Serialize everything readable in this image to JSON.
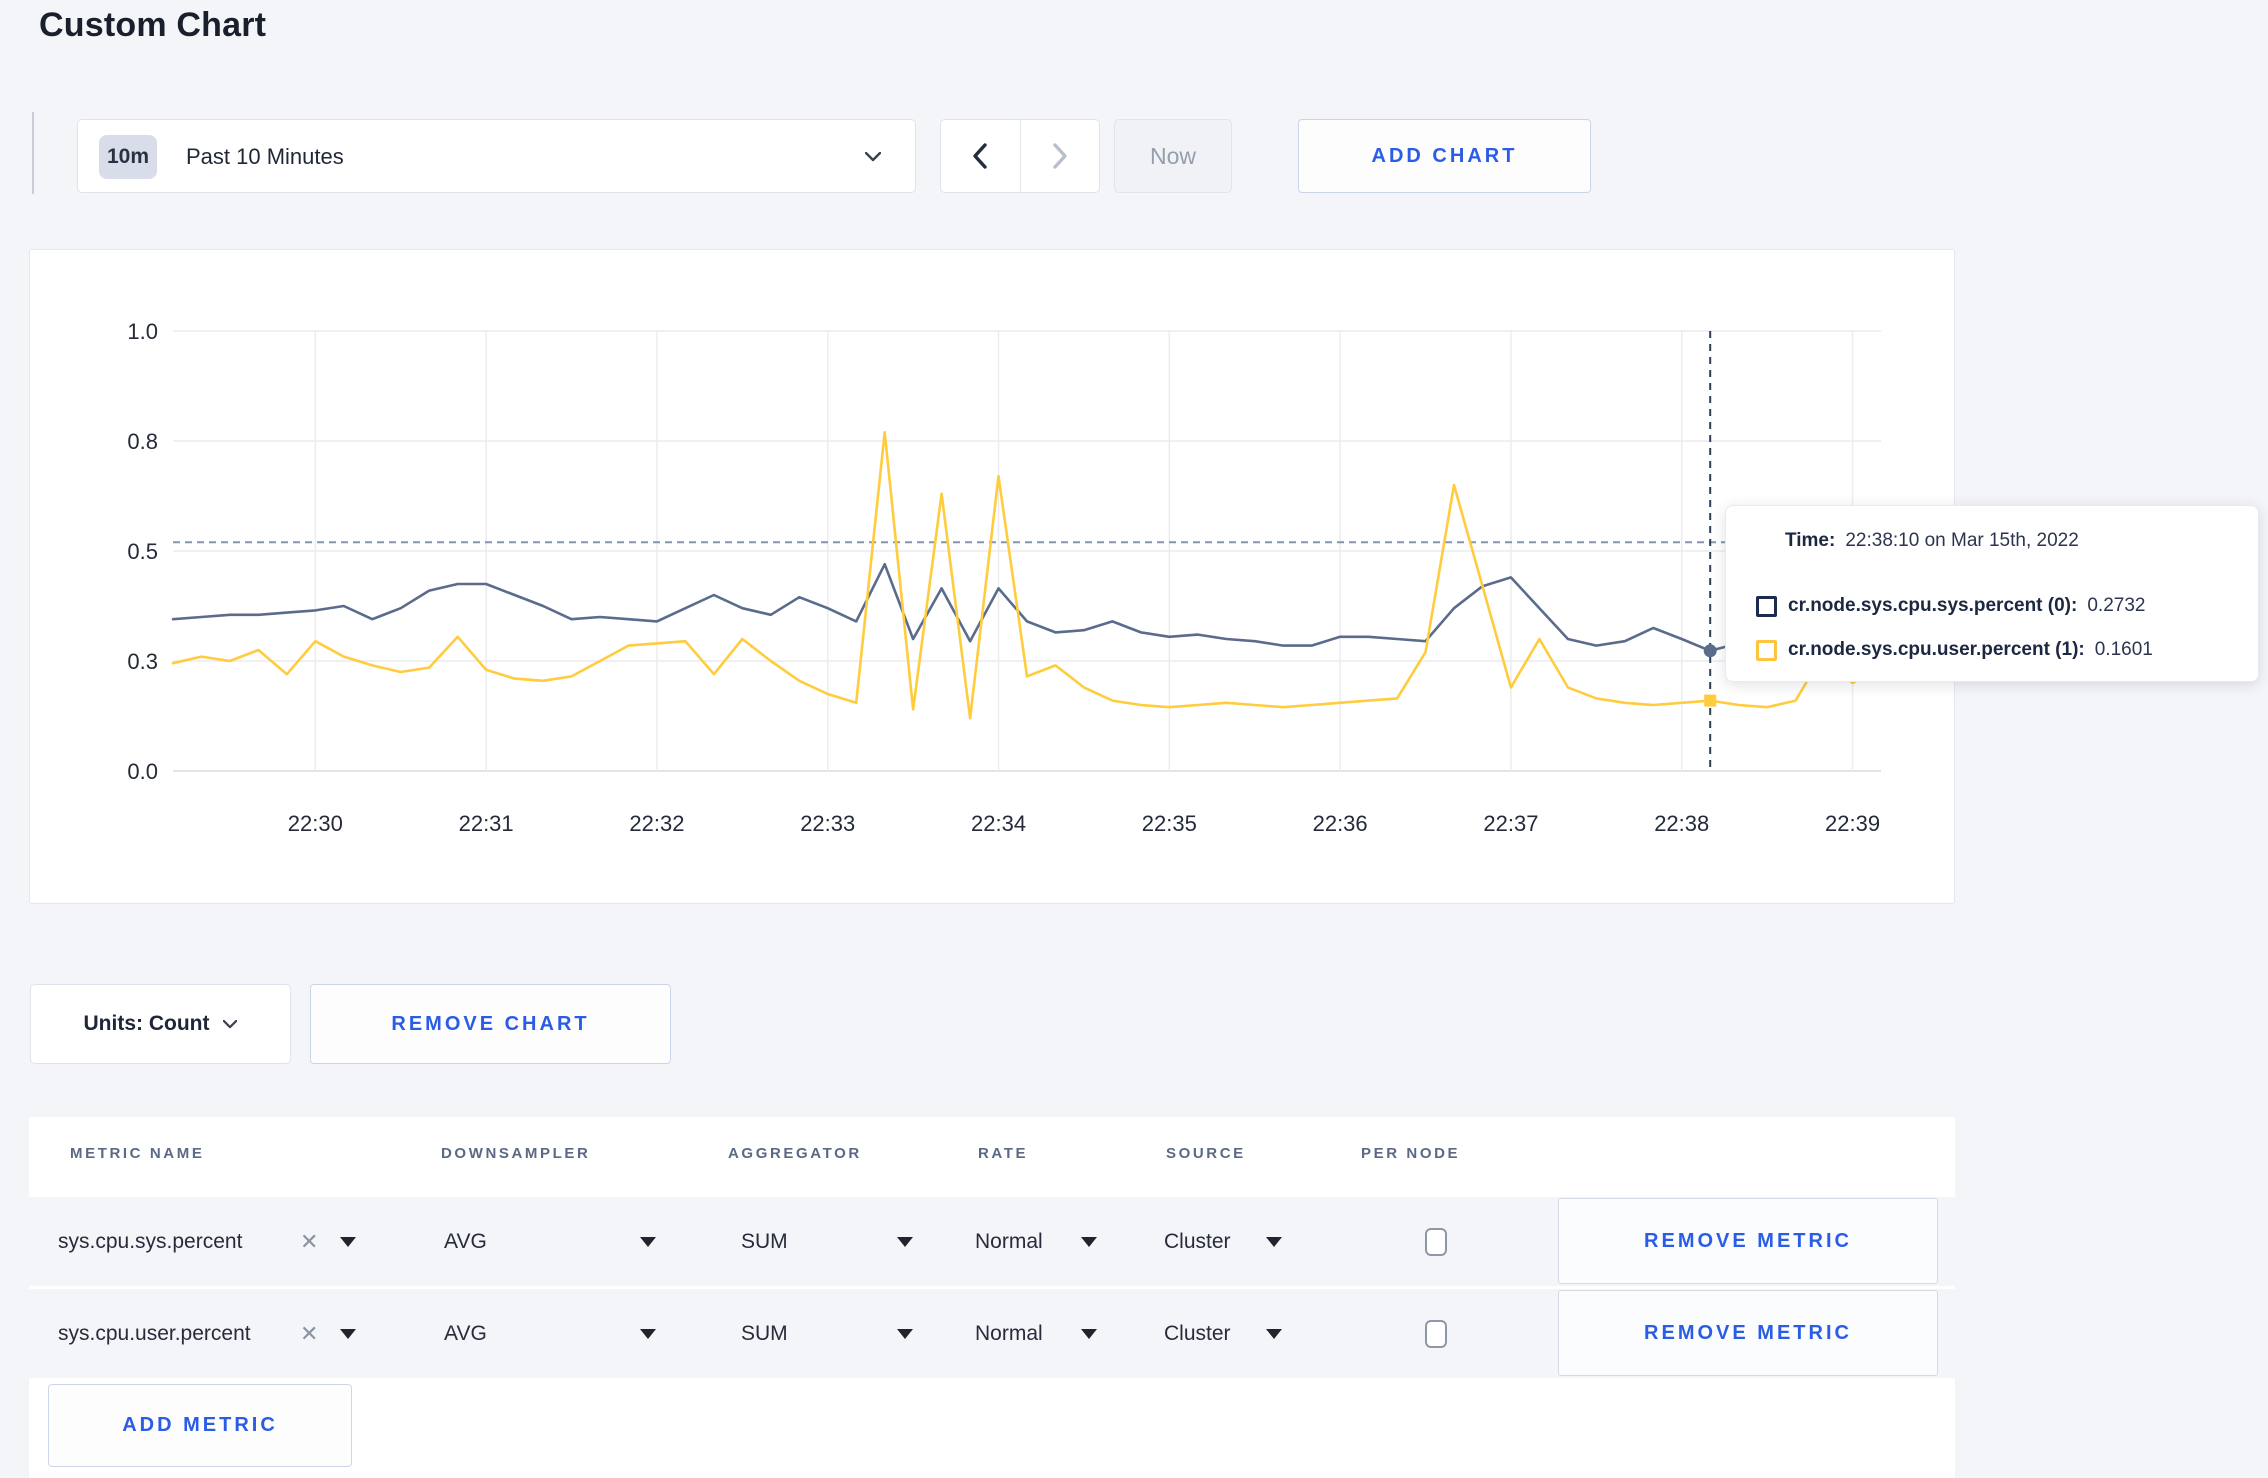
{
  "page": {
    "title": "Custom Chart",
    "accent_color": "#2b5ce6",
    "background": "#f4f5f8"
  },
  "toolbar": {
    "time_range_badge": "10m",
    "time_range_label": "Past 10 Minutes",
    "now_label": "Now",
    "add_chart_label": "ADD CHART"
  },
  "chart_data": {
    "type": "line",
    "title": "",
    "xlabel": "",
    "ylabel": "",
    "ylim": [
      0,
      1
    ],
    "grid": true,
    "x_start_time": "22:29:10",
    "sample_interval_seconds": 10,
    "x_ticks": [
      {
        "label": "22:30",
        "offset_s": 50
      },
      {
        "label": "22:31",
        "offset_s": 110
      },
      {
        "label": "22:32",
        "offset_s": 170
      },
      {
        "label": "22:33",
        "offset_s": 230
      },
      {
        "label": "22:34",
        "offset_s": 290
      },
      {
        "label": "22:35",
        "offset_s": 350
      },
      {
        "label": "22:36",
        "offset_s": 410
      },
      {
        "label": "22:37",
        "offset_s": 470
      },
      {
        "label": "22:38",
        "offset_s": 530
      },
      {
        "label": "22:39",
        "offset_s": 590
      }
    ],
    "y_ticks": [
      {
        "label": "1.0",
        "value": 1.0
      },
      {
        "label": "0.8",
        "value": 0.75
      },
      {
        "label": "0.5",
        "value": 0.5
      },
      {
        "label": "0.3",
        "value": 0.25
      },
      {
        "label": "0.0",
        "value": 0.0
      }
    ],
    "hover_guide_value": 0.52,
    "crosshair": {
      "time": "22:38:10",
      "offset_s": 540,
      "values": [
        0.2732,
        0.1601
      ]
    },
    "series": [
      {
        "name": "cr.node.sys.cpu.sys.percent",
        "color": "#5a6b8b",
        "swatch_color": "#1c2b4e",
        "values": [
          0.345,
          0.35,
          0.355,
          0.355,
          0.36,
          0.365,
          0.375,
          0.345,
          0.37,
          0.41,
          0.425,
          0.425,
          0.4,
          0.375,
          0.345,
          0.35,
          0.345,
          0.34,
          0.37,
          0.4,
          0.37,
          0.355,
          0.395,
          0.37,
          0.34,
          0.47,
          0.3,
          0.415,
          0.295,
          0.415,
          0.34,
          0.315,
          0.32,
          0.34,
          0.315,
          0.305,
          0.31,
          0.3,
          0.295,
          0.285,
          0.285,
          0.305,
          0.305,
          0.3,
          0.295,
          0.37,
          0.42,
          0.44,
          0.37,
          0.3,
          0.285,
          0.295,
          0.325,
          0.3,
          0.2732,
          0.29,
          0.3,
          0.295,
          0.29,
          0.295,
          0.3
        ]
      },
      {
        "name": "cr.node.sys.cpu.user.percent",
        "color": "#ffcc3d",
        "swatch_color": "#ffc33d",
        "values": [
          0.245,
          0.26,
          0.25,
          0.275,
          0.22,
          0.295,
          0.26,
          0.24,
          0.225,
          0.235,
          0.305,
          0.23,
          0.21,
          0.205,
          0.215,
          0.25,
          0.285,
          0.29,
          0.295,
          0.22,
          0.3,
          0.25,
          0.205,
          0.175,
          0.155,
          0.77,
          0.14,
          0.63,
          0.12,
          0.67,
          0.215,
          0.24,
          0.19,
          0.16,
          0.15,
          0.145,
          0.15,
          0.155,
          0.15,
          0.145,
          0.15,
          0.155,
          0.16,
          0.165,
          0.27,
          0.65,
          0.42,
          0.19,
          0.3,
          0.19,
          0.165,
          0.155,
          0.15,
          0.155,
          0.1601,
          0.15,
          0.145,
          0.16,
          0.27,
          0.2,
          0.235
        ]
      }
    ],
    "legend_position": "tooltip-only"
  },
  "tooltip": {
    "time_label": "Time:",
    "time_value": "22:38:10 on Mar 15th, 2022",
    "rows": [
      {
        "label": "cr.node.sys.cpu.sys.percent (0):",
        "value": "0.2732"
      },
      {
        "label": "cr.node.sys.cpu.user.percent (1):",
        "value": "0.1601"
      }
    ]
  },
  "chart_controls": {
    "units_label": "Units: Count",
    "remove_chart_label": "REMOVE CHART"
  },
  "metrics_table": {
    "headers": [
      "METRIC NAME",
      "DOWNSAMPLER",
      "AGGREGATOR",
      "RATE",
      "SOURCE",
      "PER NODE"
    ],
    "rows": [
      {
        "metric": "sys.cpu.sys.percent",
        "downsampler": "AVG",
        "aggregator": "SUM",
        "rate": "Normal",
        "source": "Cluster",
        "per_node_checked": false,
        "remove_label": "REMOVE METRIC"
      },
      {
        "metric": "sys.cpu.user.percent",
        "downsampler": "AVG",
        "aggregator": "SUM",
        "rate": "Normal",
        "source": "Cluster",
        "per_node_checked": false,
        "remove_label": "REMOVE METRIC"
      }
    ],
    "add_metric_label": "ADD METRIC"
  }
}
